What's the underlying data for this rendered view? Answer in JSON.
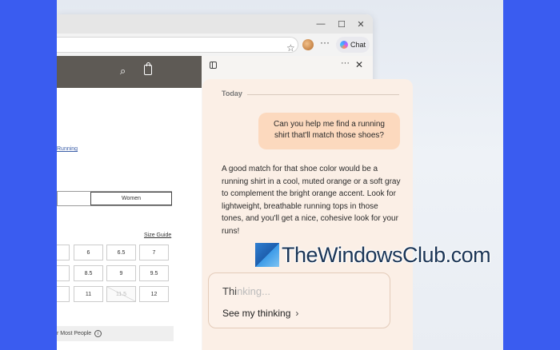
{
  "browser": {
    "window_controls": {
      "minimize": "—",
      "maximize": "☐",
      "close": "✕"
    },
    "toolbar": {
      "chat_label": "Chat",
      "more": "···"
    }
  },
  "shop": {
    "running_link": "Running",
    "gender": {
      "women_label": "Women"
    },
    "size_guide_label": "Size Guide",
    "sizes": [
      [
        "6",
        "6.5",
        "7"
      ],
      [
        "8.5",
        "9",
        "9.5"
      ],
      [
        "11",
        "11.5",
        "12"
      ]
    ],
    "partial_sizes": [
      "5",
      "5"
    ],
    "most_people_label": "r Most People"
  },
  "copilot": {
    "pane_more": "···",
    "pane_close": "✕",
    "today_label": "Today",
    "user_message": "Can you help me find a running shirt that'll match those shoes?",
    "bot_message": "A good match for that shoe color would be a running shirt in a cool, muted orange or a soft gray to complement the bright orange accent. Look for lightweight, breathable running tops in those tones, and you'll get a nice, cohesive look for your runs!",
    "thinking_label_strong": "Thi",
    "thinking_label_fade": "nking...",
    "see_thinking_label": "See my thinking",
    "chevron": "›"
  },
  "watermark": {
    "text": "TheWindowsClub.com"
  },
  "colors": {
    "accent_orange": "#fcd9be",
    "chat_panel_bg": "#fbefe6",
    "side_strip": "#3a5cf0"
  }
}
